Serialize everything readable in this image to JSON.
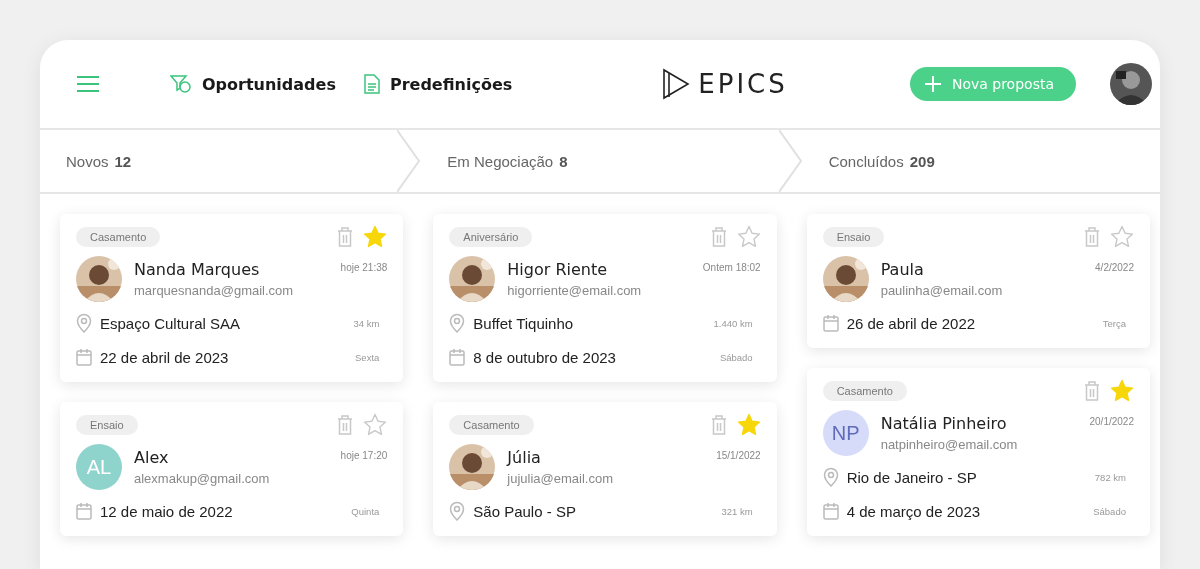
{
  "header": {
    "nav": [
      {
        "kind": "funnel",
        "label": "Oportunidades"
      },
      {
        "kind": "document",
        "label": "Predefinições"
      }
    ],
    "logo": "EPICS",
    "new_button": "Nova proposta"
  },
  "stages": [
    {
      "label": "Novos",
      "count": "12"
    },
    {
      "label": "Em Negociação",
      "count": "8"
    },
    {
      "label": "Concluídos",
      "count": "209"
    }
  ],
  "columns": [
    {
      "cards": [
        {
          "tag": "Casamento",
          "starred": true,
          "name": "Nanda Marques",
          "email": "marquesnanda@gmail.com",
          "time": "hoje 21:38",
          "location": "Espaço Cultural SAA",
          "distance": "34 km",
          "date": "22 de abril de 2023",
          "weekday": "Sexta"
        },
        {
          "tag": "Ensaio",
          "starred": false,
          "avatar": {
            "kind": "initials",
            "text": "AL",
            "color": "#8fd3cd"
          },
          "name": "Alex",
          "email": "alexmakup@gmail.com",
          "time": "hoje 17:20",
          "date": "12 de maio de 2022",
          "weekday": "Quinta"
        }
      ]
    },
    {
      "cards": [
        {
          "tag": "Aniversário",
          "starred": false,
          "name": "Higor Riente",
          "email": "higorriente@email.com",
          "time": "Ontem 18:02",
          "location": "Buffet Tiquinho",
          "distance": "1.440 km",
          "date": "8 de outubro de 2023",
          "weekday": "Sábado"
        },
        {
          "tag": "Casamento",
          "starred": true,
          "name": "Júlia",
          "email": "jujulia@email.com",
          "time": "15/1/2022",
          "location": "São Paulo - SP",
          "distance": "321 km"
        }
      ]
    },
    {
      "cards": [
        {
          "tag": "Ensaio",
          "starred": false,
          "name": "Paula",
          "email": "paulinha@email.com",
          "time": "4/2/2022",
          "date": "26 de abril de 2022",
          "weekday": "Terça"
        },
        {
          "tag": "Casamento",
          "starred": true,
          "avatar": {
            "kind": "initials",
            "text": "NP",
            "color": "#d6dbf9"
          },
          "name": "Natália Pinheiro",
          "email": "natpinheiro@email.com",
          "time": "20/1/2022",
          "location": "Rio de Janeiro - SP",
          "distance": "782 km",
          "date": "4 de março de 2023",
          "weekday": "Sábado"
        }
      ]
    }
  ]
}
